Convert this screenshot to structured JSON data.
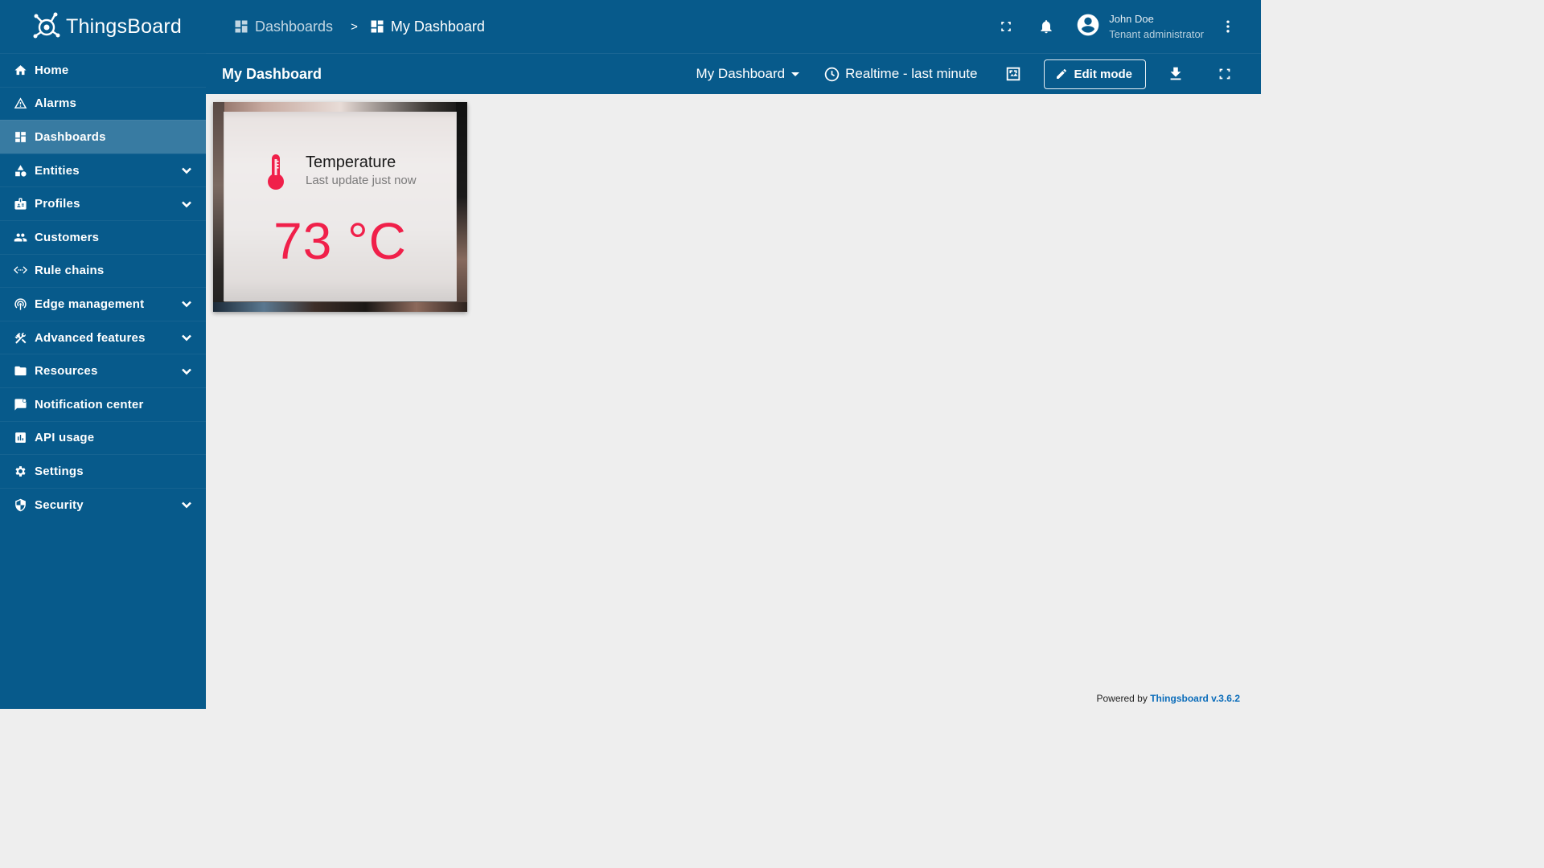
{
  "app": {
    "name": "ThingsBoard"
  },
  "sidebar": {
    "items": [
      {
        "label": "Home",
        "icon": "home-icon",
        "expandable": false,
        "active": false
      },
      {
        "label": "Alarms",
        "icon": "warning-icon",
        "expandable": false,
        "active": false
      },
      {
        "label": "Dashboards",
        "icon": "dashboard-icon",
        "expandable": false,
        "active": true
      },
      {
        "label": "Entities",
        "icon": "category-icon",
        "expandable": true,
        "active": false
      },
      {
        "label": "Profiles",
        "icon": "badge-icon",
        "expandable": true,
        "active": false
      },
      {
        "label": "Customers",
        "icon": "people-icon",
        "expandable": false,
        "active": false
      },
      {
        "label": "Rule chains",
        "icon": "settings-ethernet-icon",
        "expandable": false,
        "active": false
      },
      {
        "label": "Edge management",
        "icon": "router-icon",
        "expandable": true,
        "active": false
      },
      {
        "label": "Advanced features",
        "icon": "construction-icon",
        "expandable": true,
        "active": false
      },
      {
        "label": "Resources",
        "icon": "folder-icon",
        "expandable": true,
        "active": false
      },
      {
        "label": "Notification center",
        "icon": "notification-icon",
        "expandable": false,
        "active": false
      },
      {
        "label": "API usage",
        "icon": "insert-chart-icon",
        "expandable": false,
        "active": false
      },
      {
        "label": "Settings",
        "icon": "gear-icon",
        "expandable": false,
        "active": false
      },
      {
        "label": "Security",
        "icon": "shield-icon",
        "expandable": true,
        "active": false
      }
    ]
  },
  "breadcrumb": {
    "items": [
      {
        "label": "Dashboards"
      },
      {
        "label": "My Dashboard"
      }
    ],
    "separator": ">"
  },
  "user": {
    "name": "John Doe",
    "role": "Tenant administrator"
  },
  "toolbar": {
    "title": "My Dashboard",
    "dashboard_select": "My Dashboard",
    "timewindow": "Realtime - last minute",
    "edit_label": "Edit mode"
  },
  "widget": {
    "title": "Temperature",
    "subtitle": "Last update just now",
    "value": "73 °C",
    "value_color": "#f0204a"
  },
  "footer": {
    "prefix": "Powered by",
    "link": "Thingsboard v.3.6.2"
  },
  "colors": {
    "primary": "#075a8b",
    "accent": "#f0204a",
    "link": "#0a6cba"
  }
}
